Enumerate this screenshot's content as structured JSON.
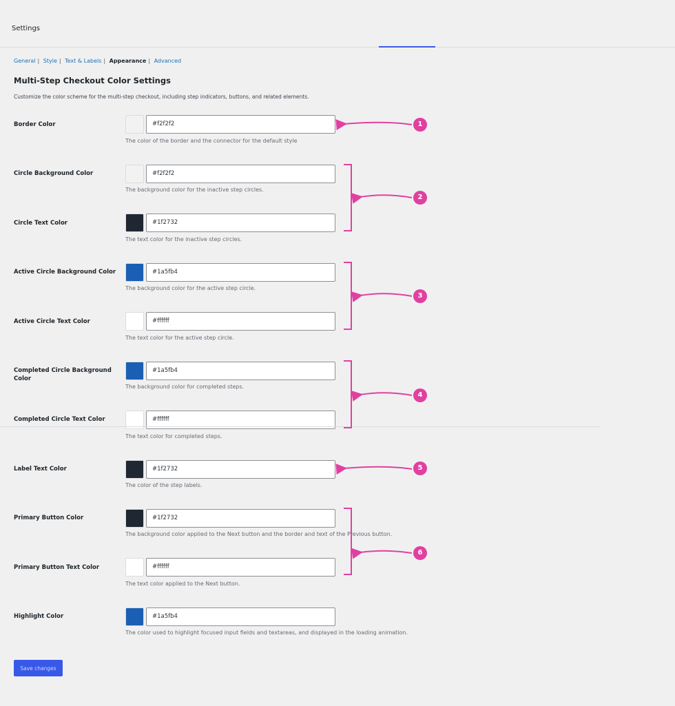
{
  "header": {
    "title": "Settings"
  },
  "subnav": {
    "items": [
      {
        "label": "General",
        "current": false
      },
      {
        "label": "Style",
        "current": false
      },
      {
        "label": "Text & Labels",
        "current": false
      },
      {
        "label": "Appearance",
        "current": true
      },
      {
        "label": "Advanced",
        "current": false
      }
    ],
    "separator": "|"
  },
  "section": {
    "title": "Multi-Step Checkout Color Settings",
    "description": "Customize the color scheme for the multi-step checkout, including step indicators, buttons, and related elements."
  },
  "fields": [
    {
      "label": "Border Color",
      "value": "#f2f2f2",
      "swatch": "#f2f2f2",
      "help": "The color of the border and the connector for the default style"
    },
    {
      "label": "Circle Background Color",
      "value": "#f2f2f2",
      "swatch": "#f2f2f2",
      "help": "The background color for the inactive step circles."
    },
    {
      "label": "Circle Text Color",
      "value": "#1f2732",
      "swatch": "#1f2732",
      "help": "The text color for the inactive step circles."
    },
    {
      "label": "Active Circle Background Color",
      "value": "#1a5fb4",
      "swatch": "#1a5fb4",
      "help": "The background color for the active step circle."
    },
    {
      "label": "Active Circle Text Color",
      "value": "#ffffff",
      "swatch": "#ffffff",
      "help": "The text color for the active step circle."
    },
    {
      "label": "Completed Circle Background Color",
      "value": "#1a5fb4",
      "swatch": "#1a5fb4",
      "help": "The background color for completed steps."
    },
    {
      "label": "Completed Circle Text Color",
      "value": "#ffffff",
      "swatch": "#ffffff",
      "help": "The text color for completed steps."
    },
    {
      "label": "Label Text Color",
      "value": "#1f2732",
      "swatch": "#1f2732",
      "help": "The color of the step labels."
    },
    {
      "label": "Primary Button Color",
      "value": "#1f2732",
      "swatch": "#1f2732",
      "help": "The background color applied to the Next button and the border and text of the Previous button."
    },
    {
      "label": "Primary Button Text Color",
      "value": "#ffffff",
      "swatch": "#ffffff",
      "help": "The text color applied to the Next button."
    },
    {
      "label": "Highlight Color",
      "value": "#1a5fb4",
      "swatch": "#1a5fb4",
      "help": "The color used to highlight focused input fields and textareas, and displayed in the loading animation."
    }
  ],
  "save_label": "Save changes",
  "annotations": {
    "color": "#e040a0",
    "badges": [
      "1",
      "2",
      "3",
      "4",
      "5",
      "6"
    ]
  }
}
